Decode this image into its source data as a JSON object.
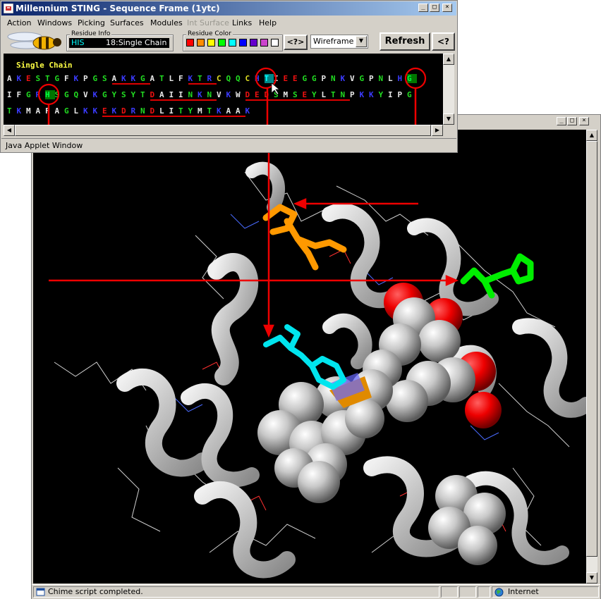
{
  "chime_window": {
    "status_message": "Chime script completed.",
    "zone": "Internet"
  },
  "sting_window": {
    "title": "Millennium STING - Sequence Frame (1ytc)",
    "menu": [
      "Action",
      "Windows",
      "Picking",
      "Surfaces",
      "Modules",
      "Int Surface",
      "Links",
      "Help"
    ],
    "disabled_menu": "Int Surface",
    "residue_info": {
      "label": "Residue Info",
      "residue": "HIS",
      "detail": "18:Single Chain"
    },
    "residue_color": {
      "label": "Residue Color",
      "colors": [
        "#ff0000",
        "#ff8c00",
        "#ffff00",
        "#00ff00",
        "#00ffff",
        "#0000ff",
        "#6600cc",
        "#cc44cc",
        "#ffffff"
      ]
    },
    "help_query_label": "<?>",
    "render_mode": "Wireframe",
    "refresh_label": "Refresh",
    "help_label": "<?",
    "chain_label": "Single Chain",
    "sequence": {
      "line1": "AKESTGFKPGSAKKGATLFKTRCQQCHTIEEGGPNKVGPNLHG",
      "line2": "IFGRHSGQVKGYSYTDAIINKNVKWDEDSMSEYLTNPKKYIPG",
      "line3": "TKMAFAGLKKEKDRNDLITYMTKAAK"
    },
    "applet_status": "Java Applet Window"
  },
  "colors": {
    "title_bar": "#0a246a",
    "arrow": "#ee0000",
    "highlight_cyan": "#00ffff",
    "highlight_green": "#00dd00",
    "highlight_orange": "#ff9900"
  }
}
